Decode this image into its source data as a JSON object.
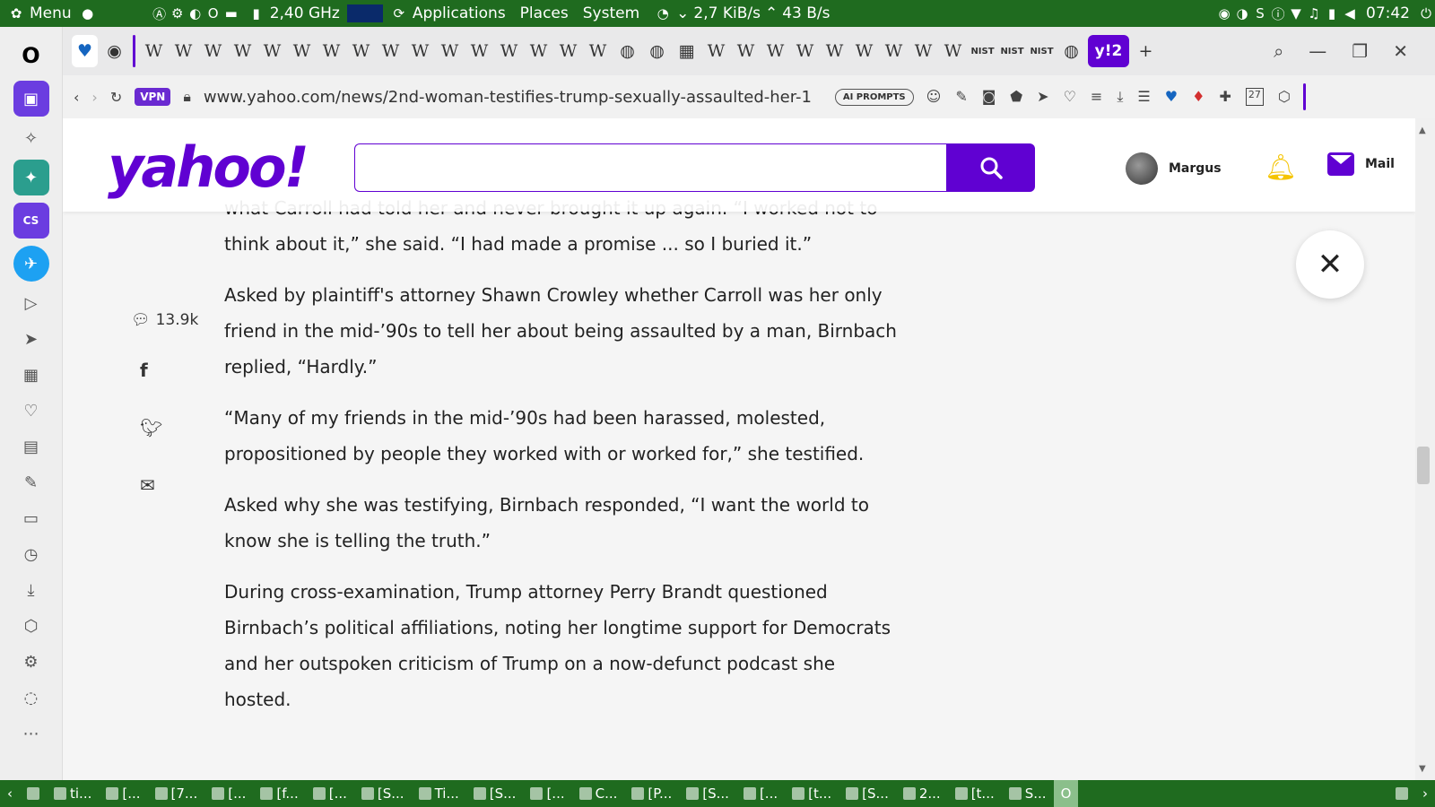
{
  "system_panel": {
    "menu_label": "Menu",
    "cpu_freq": "2,40 GHz",
    "launchers": [
      "Applications",
      "Places",
      "System"
    ],
    "net_down": "2,7 KiB/s",
    "net_up": "43 B/s",
    "clock": "07:42"
  },
  "tabs": {
    "pinned_letter": "W",
    "nist_label": "NIST",
    "active_label": "2",
    "count_w": 28
  },
  "address": {
    "vpn": "VPN",
    "url": "www.yahoo.com/news/2nd-woman-testifies-trump-sexually-assaulted-her-1",
    "ai_prompts": "AI PROMPTS",
    "badge": "27"
  },
  "yahoo": {
    "logo": "yahoo!",
    "search_value": "",
    "user_name": "Margus",
    "mail_label": "Mail"
  },
  "social": {
    "comment_count": "13.9k"
  },
  "article": {
    "paragraphs": [
      "what Carroll had told her and never brought it up again. “I worked not to think about it,” she said. “I had made a promise ... so I buried it.”",
      "Asked by plaintiff's attorney Shawn Crowley whether Carroll was her only friend in the mid-’90s to tell her about being assaulted by a man, Birnbach replied, “Hardly.”",
      "“Many of my friends in the mid-’90s had been harassed, molested, propositioned by people they worked with or worked for,” she testified.",
      "Asked why she was testifying, Birnbach responded, “I want the world to know she is telling the truth.”",
      "During cross-examination, Trump attorney Perry Brandt questioned Birnbach’s political affiliations, noting her longtime support for Democrats and her outspoken criticism of Trump on a now-defunct podcast she hosted."
    ]
  },
  "taskbar": {
    "items": [
      "ti...",
      "[...",
      "[7...",
      "[...",
      "[f...",
      "[...",
      "[S...",
      "Ti...",
      "[S...",
      "[...",
      "C...",
      "[P...",
      "[S...",
      "[...",
      "[t...",
      "[S...",
      "2...",
      "[t...",
      "S..."
    ]
  },
  "colors": {
    "panel": "#1f6b1f",
    "yahoo_purple": "#6001d2"
  }
}
